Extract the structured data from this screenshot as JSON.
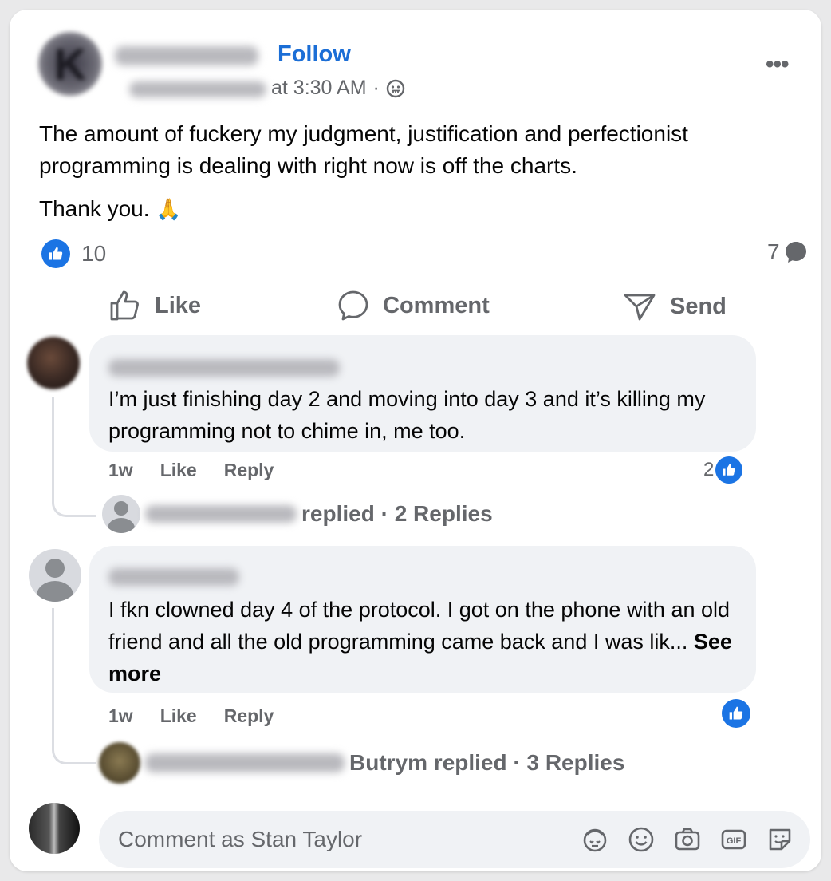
{
  "post": {
    "follow_label": "Follow",
    "time_suffix": "at 3:30 AM",
    "dot": "·",
    "body_line1": "The amount of fuckery my judgment, justification and perfectionist programming is dealing with right now is off the charts.",
    "body_line2": "Thank you.",
    "emoji": "🙏",
    "like_count": "10",
    "comment_count": "7"
  },
  "actions": {
    "like": "Like",
    "comment": "Comment",
    "send": "Send"
  },
  "comments": [
    {
      "text": "I’m just finishing day 2 and moving into day 3 and it’s killing my programming not to chime in, me too.",
      "time": "1w",
      "like": "Like",
      "reply": "Reply",
      "reaction_count": "2",
      "replies_text": "replied · 2 Replies"
    },
    {
      "text": "I fkn clowned day 4 of the protocol. I got on the phone with an old friend and all the old programming came back and I was lik...",
      "see_more": "See more",
      "time": "1w",
      "like": "Like",
      "reply": "Reply",
      "replies_text": "Butrym replied · 3 Replies"
    }
  ],
  "composer": {
    "placeholder": "Comment as Stan Taylor"
  },
  "colors": {
    "accent": "#1b74e4",
    "follow": "#1b6ed6",
    "muted": "#65676b",
    "bubble": "#f0f2f5"
  },
  "icons": [
    "privacy-globe-icon",
    "like-icon",
    "comment-icon",
    "send-icon",
    "avatar-sticker-icon",
    "emoji-icon",
    "camera-icon",
    "gif-icon",
    "sticker-icon"
  ]
}
